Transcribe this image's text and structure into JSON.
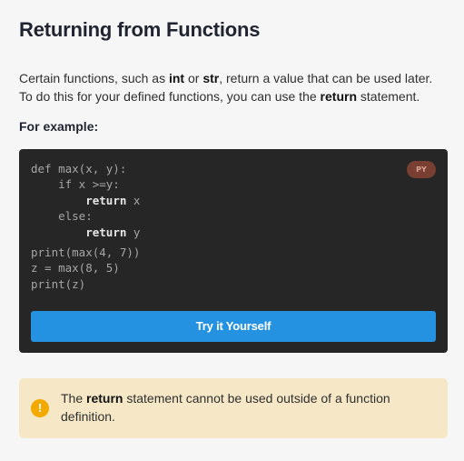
{
  "lesson": {
    "title": "Returning from Functions",
    "intro": {
      "line1_before_int": "Certain functions, such as ",
      "keyword_int": "int",
      "line1_or": " or ",
      "keyword_str": "str",
      "line1_after": ", return a value that can be used later.",
      "line2_before": "To do this for your defined functions, you can use the ",
      "keyword_return": "return",
      "line2_after": " statement."
    },
    "example_label": "For example:"
  },
  "code_block": {
    "language_badge": "PY",
    "lines": {
      "l1": "def max(x, y):",
      "l2": "    if x >=y:",
      "l3_indent": "        ",
      "l3_kw": "return",
      "l3_rest": " x",
      "l4": "    else:",
      "l5_indent": "        ",
      "l5_kw": "return",
      "l5_rest": " y",
      "l6": "print(max(4, 7))",
      "l7": "z = max(8, 5)",
      "l8": "print(z)"
    },
    "try_button_label": "Try it Yourself"
  },
  "note": {
    "icon_symbol": "!",
    "icon_name": "exclamation-icon",
    "text_before": "The ",
    "keyword": "return",
    "text_after": " statement cannot be used outside of a function definition."
  },
  "colors": {
    "background": "#f6f6f6",
    "code_background": "#262626",
    "button": "#2592e1",
    "badge": "#7a3f33",
    "note_background": "#f6e8c6",
    "note_icon": "#f2a900"
  }
}
